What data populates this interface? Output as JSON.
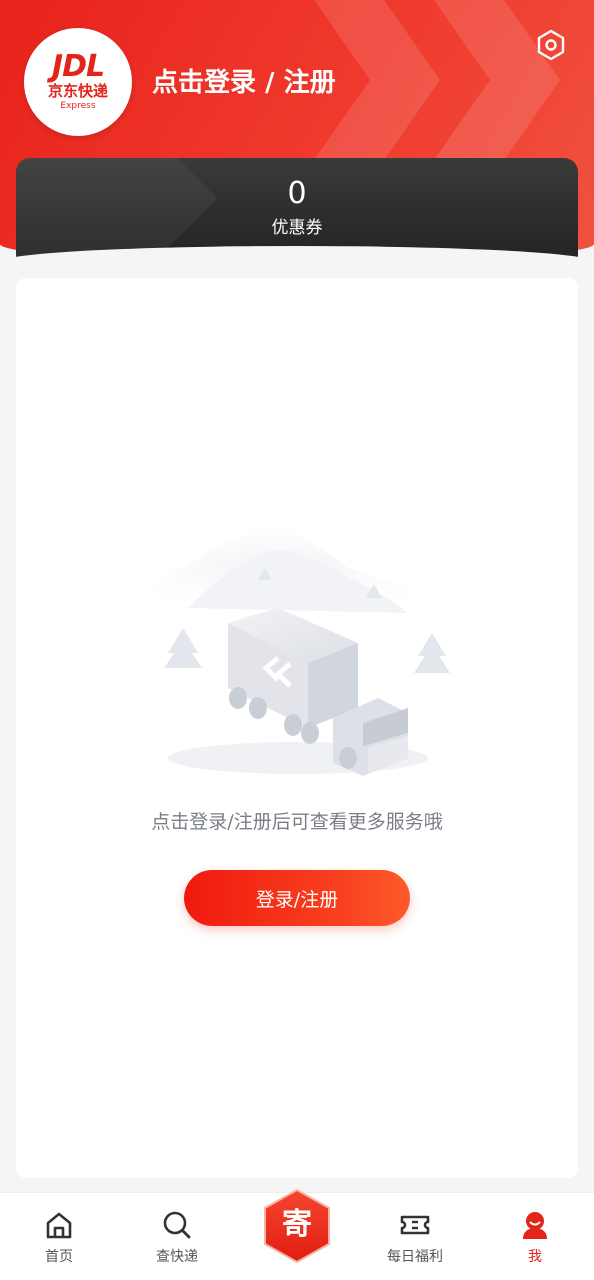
{
  "header": {
    "logo": {
      "mark": "JDL",
      "cn": "京东快递",
      "en": "Express"
    },
    "login_title": "点击登录 / 注册",
    "settings_icon": "settings-hex-icon",
    "accent_color": "#e8231c"
  },
  "coupon": {
    "count": "0",
    "label": "优惠券"
  },
  "main": {
    "illustration": "empty-truck-illustration",
    "hint": "点击登录/注册后可查看更多服务哦",
    "login_button": "登录/注册"
  },
  "bottom_nav": {
    "items": [
      {
        "label": "首页",
        "icon": "home-icon"
      },
      {
        "label": "查快递",
        "icon": "search-icon"
      },
      {
        "label": "寄",
        "icon": "ship-icon"
      },
      {
        "label": "每日福利",
        "icon": "ticket-icon"
      },
      {
        "label": "我",
        "icon": "profile-icon",
        "active": true
      }
    ]
  }
}
